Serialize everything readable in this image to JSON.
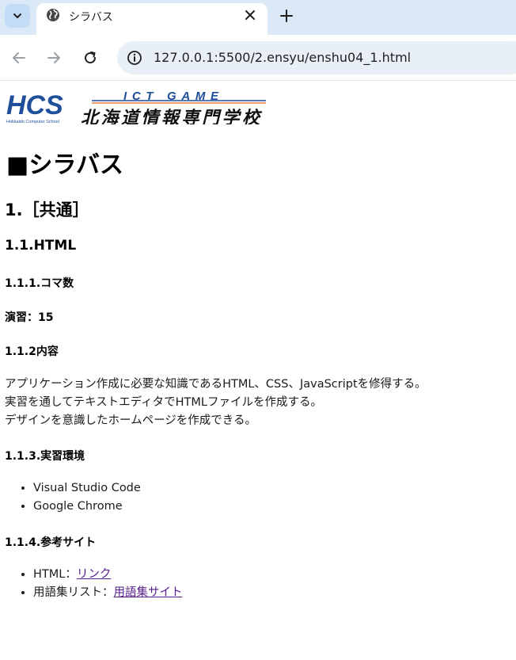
{
  "browser": {
    "tab_title": "シラバス",
    "url": "127.0.0.1:5500/2.ensyu/enshu04_1.html"
  },
  "page": {
    "logo": {
      "brand": "HCS",
      "brand_sub": "Hokkaido Computer School",
      "tagline": "ICT GAME",
      "school_name": "北海道情報専門学校"
    },
    "h1": "■シラバス",
    "h2": "1.［共通］",
    "h3": "1.1.HTML",
    "section_koma": "1.1.1.コマ数",
    "koma_value": "演習：15",
    "section_naiyou": "1.1.2内容",
    "naiyou_lines": [
      "アプリケーション作成に必要な知識であるHTML、CSS、JavaScriptを修得する。",
      "実習を通してテキストエディタでHTMLファイルを作成する。",
      "デザインを意識したホームページを作成できる。"
    ],
    "section_kankyou": "1.1.3.実習環境",
    "kankyou_items": [
      "Visual Studio Code",
      "Google Chrome"
    ],
    "section_sankou": "1.1.4.参考サイト",
    "sankou_items": [
      {
        "prefix": "HTML：",
        "link": "リンク"
      },
      {
        "prefix": "用語集リスト：",
        "link": "用語集サイト"
      }
    ]
  }
}
